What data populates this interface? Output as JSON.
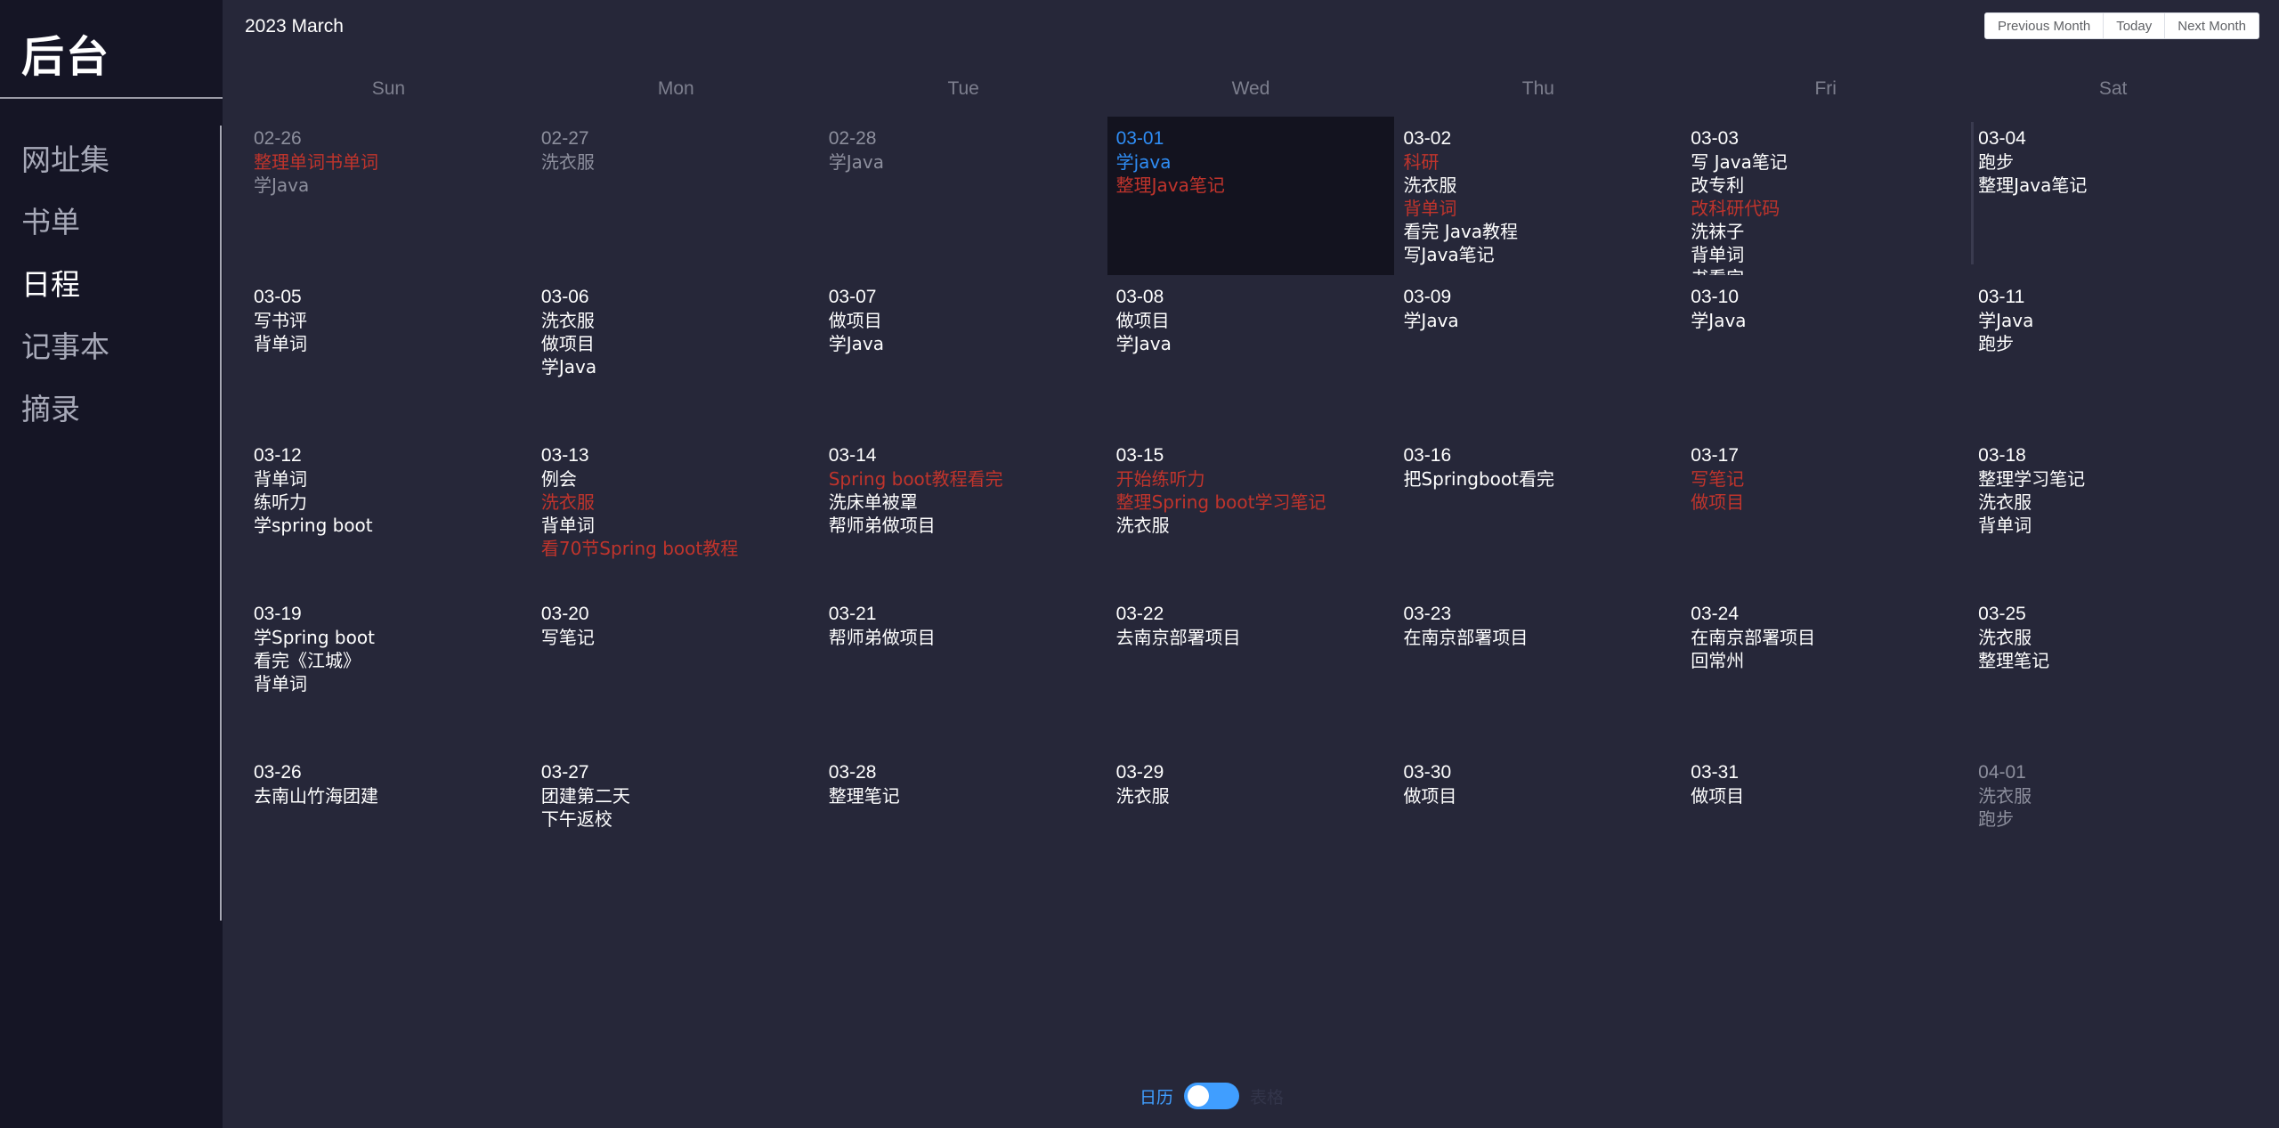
{
  "sidebar": {
    "brand": "后台",
    "items": [
      {
        "label": "网址集",
        "active": false
      },
      {
        "label": "书单",
        "active": false
      },
      {
        "label": "日程",
        "active": true
      },
      {
        "label": "记事本",
        "active": false
      },
      {
        "label": "摘录",
        "active": false
      }
    ]
  },
  "calendar": {
    "title": "2023 March",
    "buttons": {
      "prev": "Previous Month",
      "today": "Today",
      "next": "Next Month"
    },
    "weekdays": [
      "Sun",
      "Mon",
      "Tue",
      "Wed",
      "Thu",
      "Fri",
      "Sat"
    ],
    "days": [
      {
        "date": "02-26",
        "other": true,
        "events": [
          {
            "t": "整理单词书单词",
            "c": "red"
          },
          {
            "t": "学Java"
          }
        ]
      },
      {
        "date": "02-27",
        "other": true,
        "events": [
          {
            "t": "洗衣服"
          }
        ]
      },
      {
        "date": "02-28",
        "other": true,
        "events": [
          {
            "t": "学Java"
          }
        ]
      },
      {
        "date": "03-01",
        "selected": true,
        "events": [
          {
            "t": "学java",
            "c": "blue"
          },
          {
            "t": "整理Java笔记",
            "c": "red"
          }
        ]
      },
      {
        "date": "03-02",
        "events": [
          {
            "t": "科研",
            "c": "red"
          },
          {
            "t": "洗衣服"
          },
          {
            "t": "背单词",
            "c": "red"
          },
          {
            "t": "看完 Java教程"
          },
          {
            "t": "写Java笔记"
          }
        ]
      },
      {
        "date": "03-03",
        "events": [
          {
            "t": "写 Java笔记"
          },
          {
            "t": "改专利"
          },
          {
            "t": "改科研代码",
            "c": "red"
          },
          {
            "t": "洗袜子"
          },
          {
            "t": "背单词"
          },
          {
            "t": "书看完"
          }
        ]
      },
      {
        "date": "03-04",
        "edge": true,
        "events": [
          {
            "t": "跑步"
          },
          {
            "t": "整理Java笔记"
          }
        ]
      },
      {
        "date": "03-05",
        "events": [
          {
            "t": "写书评"
          },
          {
            "t": "背单词"
          }
        ]
      },
      {
        "date": "03-06",
        "events": [
          {
            "t": "洗衣服"
          },
          {
            "t": "做项目"
          },
          {
            "t": "学Java"
          }
        ]
      },
      {
        "date": "03-07",
        "events": [
          {
            "t": "做项目"
          },
          {
            "t": "学Java"
          }
        ]
      },
      {
        "date": "03-08",
        "events": [
          {
            "t": "做项目"
          },
          {
            "t": "学Java"
          }
        ]
      },
      {
        "date": "03-09",
        "events": [
          {
            "t": "学Java"
          }
        ]
      },
      {
        "date": "03-10",
        "events": [
          {
            "t": "学Java"
          }
        ]
      },
      {
        "date": "03-11",
        "events": [
          {
            "t": "学Java"
          },
          {
            "t": "跑步"
          }
        ]
      },
      {
        "date": "03-12",
        "events": [
          {
            "t": "背单词"
          },
          {
            "t": "练听力"
          },
          {
            "t": "学spring boot"
          }
        ]
      },
      {
        "date": "03-13",
        "events": [
          {
            "t": "例会"
          },
          {
            "t": "洗衣服",
            "c": "red"
          },
          {
            "t": "背单词"
          },
          {
            "t": "看70节Spring boot教程",
            "c": "red"
          }
        ]
      },
      {
        "date": "03-14",
        "events": [
          {
            "t": "Spring boot教程看完",
            "c": "red"
          },
          {
            "t": "洗床单被罩"
          },
          {
            "t": "帮师弟做项目"
          }
        ]
      },
      {
        "date": "03-15",
        "events": [
          {
            "t": "开始练听力",
            "c": "red"
          },
          {
            "t": "整理Spring boot学习笔记",
            "c": "red"
          },
          {
            "t": "洗衣服"
          }
        ]
      },
      {
        "date": "03-16",
        "events": [
          {
            "t": "把Springboot看完"
          }
        ]
      },
      {
        "date": "03-17",
        "events": [
          {
            "t": "写笔记",
            "c": "red"
          },
          {
            "t": "做项目",
            "c": "red"
          }
        ]
      },
      {
        "date": "03-18",
        "events": [
          {
            "t": "整理学习笔记"
          },
          {
            "t": "洗衣服"
          },
          {
            "t": "背单词"
          }
        ]
      },
      {
        "date": "03-19",
        "events": [
          {
            "t": "学Spring boot"
          },
          {
            "t": "看完《江城》"
          },
          {
            "t": "背单词"
          }
        ]
      },
      {
        "date": "03-20",
        "events": [
          {
            "t": "写笔记"
          }
        ]
      },
      {
        "date": "03-21",
        "events": [
          {
            "t": "帮师弟做项目"
          }
        ]
      },
      {
        "date": "03-22",
        "events": [
          {
            "t": "去南京部署项目"
          }
        ]
      },
      {
        "date": "03-23",
        "events": [
          {
            "t": "在南京部署项目"
          }
        ]
      },
      {
        "date": "03-24",
        "events": [
          {
            "t": "在南京部署项目"
          },
          {
            "t": "回常州"
          }
        ]
      },
      {
        "date": "03-25",
        "events": [
          {
            "t": "洗衣服"
          },
          {
            "t": "整理笔记"
          }
        ]
      },
      {
        "date": "03-26",
        "events": [
          {
            "t": "去南山竹海团建"
          }
        ]
      },
      {
        "date": "03-27",
        "events": [
          {
            "t": "团建第二天"
          },
          {
            "t": "下午返校"
          }
        ]
      },
      {
        "date": "03-28",
        "events": [
          {
            "t": "整理笔记"
          }
        ]
      },
      {
        "date": "03-29",
        "events": [
          {
            "t": "洗衣服"
          }
        ]
      },
      {
        "date": "03-30",
        "events": [
          {
            "t": "做项目"
          }
        ]
      },
      {
        "date": "03-31",
        "events": [
          {
            "t": "做项目"
          }
        ]
      },
      {
        "date": "04-01",
        "other": true,
        "events": [
          {
            "t": "洗衣服"
          },
          {
            "t": "跑步"
          }
        ]
      }
    ]
  },
  "toggle": {
    "left_label": "日历",
    "right_label": "表格",
    "checked": false
  },
  "colors": {
    "accent": "#409eff",
    "event_red": "#c0342c",
    "selected_blue": "#2f8df5",
    "sidebar_bg": "#151525",
    "main_bg": "#262739"
  }
}
